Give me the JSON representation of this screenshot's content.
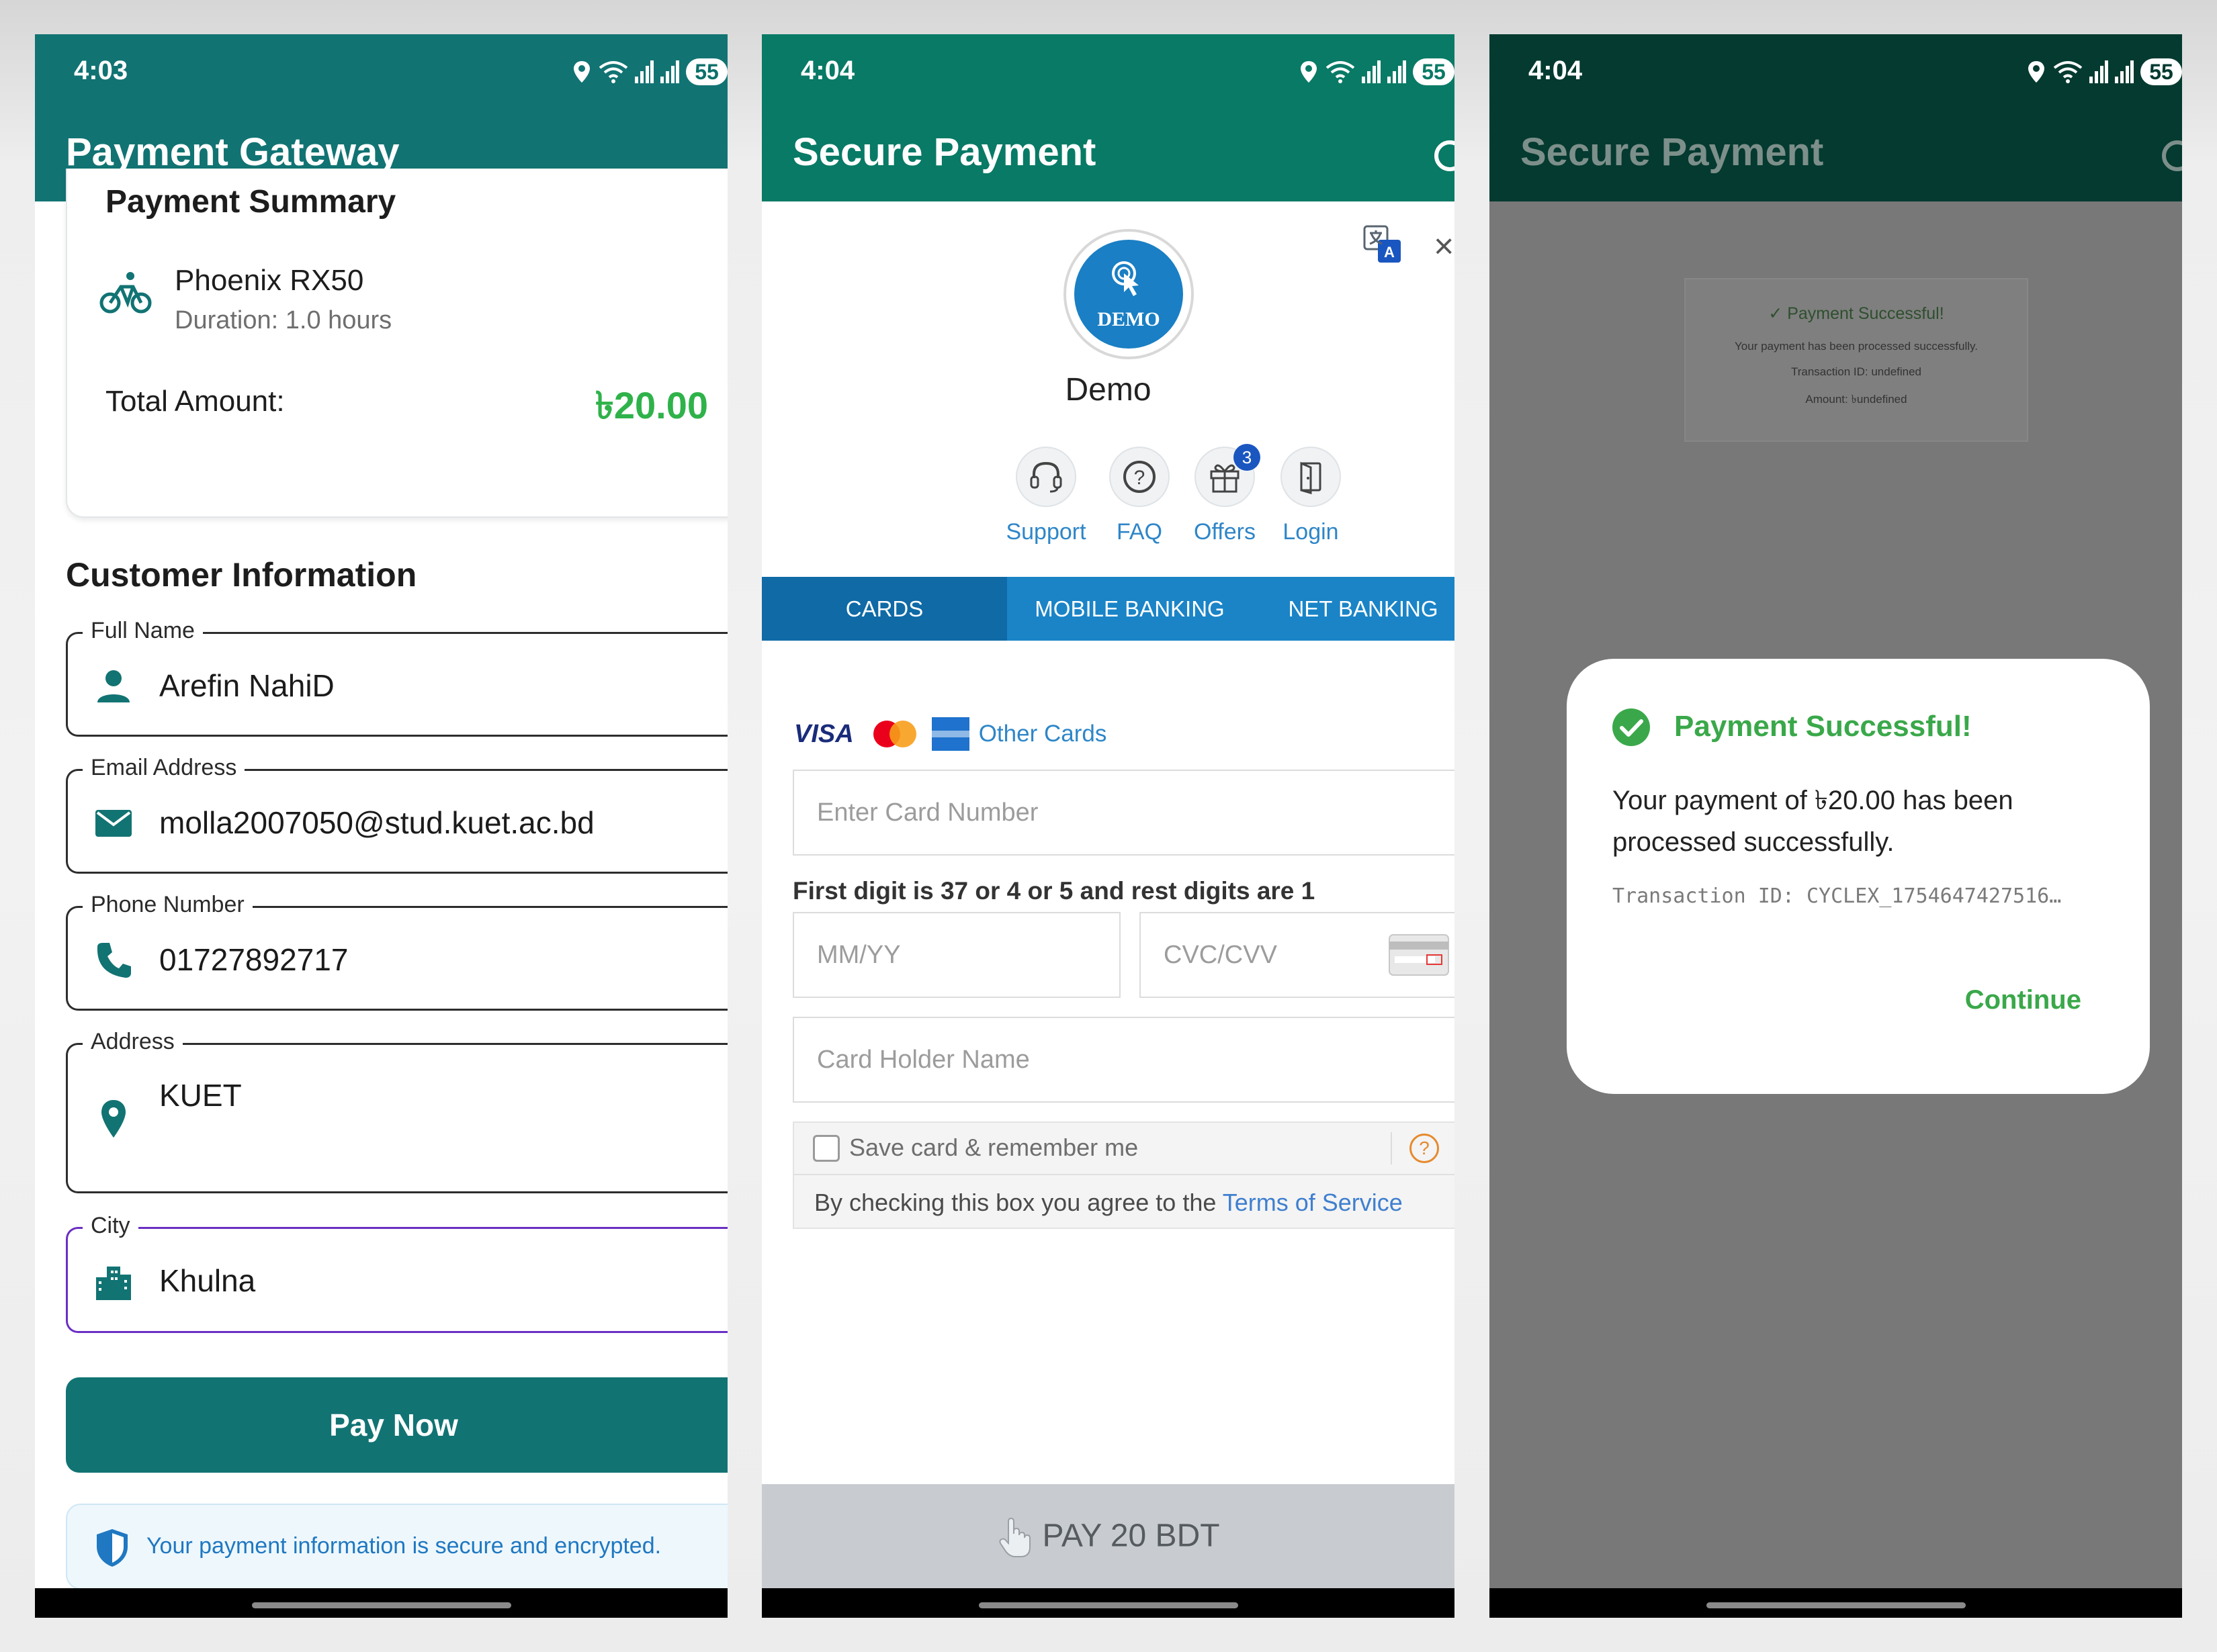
{
  "screen1": {
    "status_time": "4:03",
    "battery": "55",
    "title": "Payment Gateway",
    "summary": {
      "title": "Payment Summary",
      "item_name": "Phoenix RX50",
      "duration": "Duration: 1.0 hours",
      "total_label": "Total Amount:",
      "total_value": "৳20.00"
    },
    "customer": {
      "title": "Customer Information",
      "full_name_label": "Full Name",
      "full_name": "Arefin NahiD",
      "email_label": "Email Address",
      "email": "molla2007050@stud.kuet.ac.bd",
      "phone_label": "Phone Number",
      "phone": "01727892717",
      "address_label": "Address",
      "address": "KUET",
      "city_label": "City",
      "city": "Khulna"
    },
    "pay_button": "Pay Now",
    "secure_note": "Your payment information is secure and encrypted."
  },
  "screen2": {
    "status_time": "4:04",
    "battery": "55",
    "title": "Secure Payment",
    "merchant_logo_text": "DEMO",
    "merchant_name": "Demo",
    "quick_links": {
      "support": "Support",
      "faq": "FAQ",
      "offers": "Offers",
      "offers_badge": "3",
      "login": "Login"
    },
    "tabs": {
      "cards": "CARDS",
      "mobile_banking": "MOBILE BANKING",
      "net_banking": "NET BANKING"
    },
    "brands": {
      "visa": "VISA",
      "other_cards": "Other Cards"
    },
    "card_number_placeholder": "Enter Card Number",
    "hint": "First digit is 37 or 4 or 5 and rest digits are 1",
    "expiry_placeholder": "MM/YY",
    "cvc_placeholder": "CVC/CVV",
    "holder_placeholder": "Card Holder Name",
    "save_card_label": "Save card & remember me",
    "save_help": "?",
    "terms_prefix": "By checking this box you agree to the ",
    "terms_link": "Terms of Service",
    "pay_bar": "PAY 20 BDT"
  },
  "screen3": {
    "status_time": "4:04",
    "battery": "55",
    "title": "Secure Payment",
    "background_card": {
      "title": "✓ Payment Successful!",
      "line1": "Your payment has been processed successfully.",
      "line2": "Transaction ID: undefined",
      "line3": "Amount: ৳undefined"
    },
    "dialog": {
      "title": "Payment Successful!",
      "message": "Your payment of ৳20.00 has been processed successfully.",
      "transaction": "Transaction ID: CYCLEX_1754647427516…",
      "continue": "Continue"
    }
  },
  "colors": {
    "gateway_teal": "#127373",
    "secure_green": "#087a66",
    "success_green": "#3aa84a",
    "amount_green": "#2fb24a",
    "tab_blue": "#1a84c7",
    "link_blue": "#2e86c8",
    "focus_purple": "#6a2fc4"
  }
}
